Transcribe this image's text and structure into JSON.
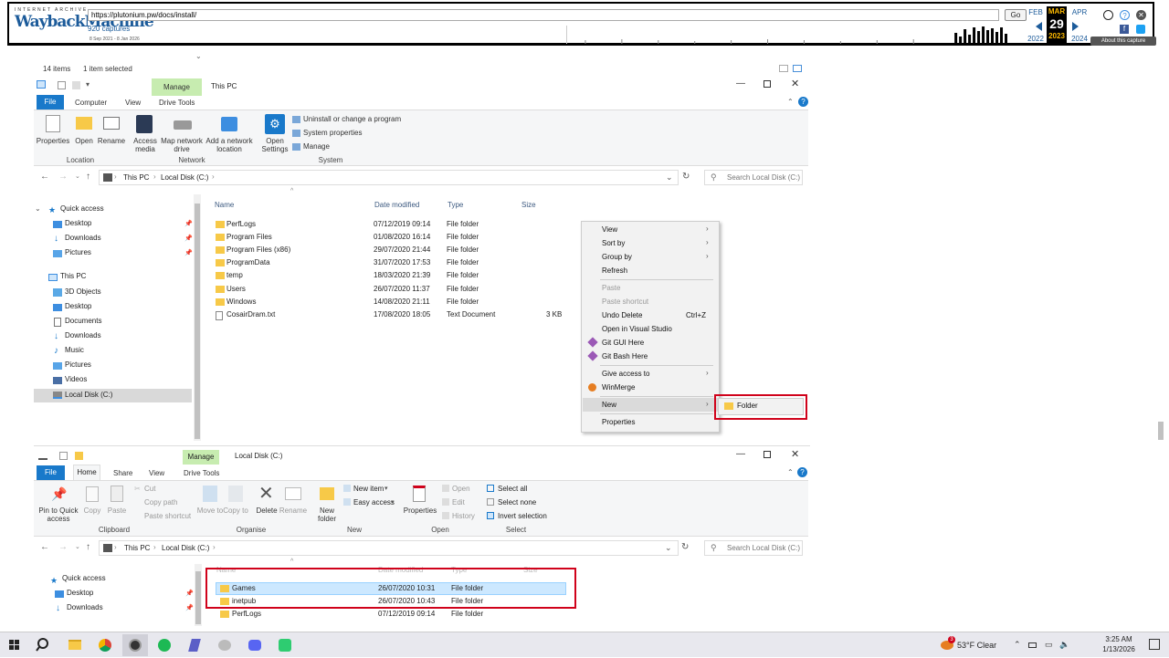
{
  "wayback": {
    "logo_top": "INTERNET ARCHIVE",
    "logo_main": "WaybackMachine",
    "url": "https://plutonium.pw/docs/install/",
    "go": "Go",
    "captures": "920 captures",
    "range": "8 Sep 2021 - 8 Jan 2026",
    "prev_month": "FEB",
    "cur_month": "MAR",
    "cur_day": "29",
    "cur_year": "2023",
    "next_month": "APR",
    "prev_year": "2022",
    "next_year": "2024",
    "about": "About this capture"
  },
  "status": {
    "items": "14 items",
    "selected": "1 item selected"
  },
  "win1": {
    "manage_tab": "Manage",
    "title": "This PC",
    "tabs": [
      "File",
      "Computer",
      "View",
      "Drive Tools"
    ],
    "ribbon": {
      "properties": "Properties",
      "open": "Open",
      "rename": "Rename",
      "access_media": "Access media",
      "map_drive": "Map network drive",
      "add_location": "Add a network location",
      "open_settings": "Open Settings",
      "uninstall": "Uninstall or change a program",
      "system_props": "System properties",
      "manage": "Manage",
      "group_location": "Location",
      "group_network": "Network",
      "group_system": "System"
    },
    "breadcrumb": [
      "This PC",
      "Local Disk (C:)"
    ],
    "search_placeholder": "Search Local Disk (C:)",
    "nav": [
      {
        "label": "Quick access"
      },
      {
        "label": "Desktop"
      },
      {
        "label": "Downloads"
      },
      {
        "label": "Pictures"
      },
      {
        "label": "This PC"
      },
      {
        "label": "3D Objects"
      },
      {
        "label": "Desktop"
      },
      {
        "label": "Documents"
      },
      {
        "label": "Downloads"
      },
      {
        "label": "Music"
      },
      {
        "label": "Pictures"
      },
      {
        "label": "Videos"
      },
      {
        "label": "Local Disk (C:)"
      }
    ],
    "columns": {
      "name": "Name",
      "date": "Date modified",
      "type": "Type",
      "size": "Size"
    },
    "files": [
      {
        "name": "PerfLogs",
        "date": "07/12/2019 09:14",
        "type": "File folder",
        "size": ""
      },
      {
        "name": "Program Files",
        "date": "01/08/2020 16:14",
        "type": "File folder",
        "size": ""
      },
      {
        "name": "Program Files (x86)",
        "date": "29/07/2020 21:44",
        "type": "File folder",
        "size": ""
      },
      {
        "name": "ProgramData",
        "date": "31/07/2020 17:53",
        "type": "File folder",
        "size": ""
      },
      {
        "name": "temp",
        "date": "18/03/2020 21:39",
        "type": "File folder",
        "size": ""
      },
      {
        "name": "Users",
        "date": "26/07/2020 11:37",
        "type": "File folder",
        "size": ""
      },
      {
        "name": "Windows",
        "date": "14/08/2020 21:11",
        "type": "File folder",
        "size": ""
      },
      {
        "name": "CosairDram.txt",
        "date": "17/08/2020 18:05",
        "type": "Text Document",
        "size": "3 KB"
      }
    ]
  },
  "context_menu": {
    "view": "View",
    "sort_by": "Sort by",
    "group_by": "Group by",
    "refresh": "Refresh",
    "paste": "Paste",
    "paste_shortcut": "Paste shortcut",
    "undo_delete": "Undo Delete",
    "undo_shortcut": "Ctrl+Z",
    "open_vs": "Open in Visual Studio",
    "git_gui": "Git GUI Here",
    "git_bash": "Git Bash Here",
    "give_access": "Give access to",
    "winmerge": "WinMerge",
    "new": "New",
    "properties": "Properties",
    "submenu_folder": "Folder"
  },
  "win2": {
    "manage_tab": "Manage",
    "title": "Local Disk (C:)",
    "tabs": [
      "File",
      "Home",
      "Share",
      "View",
      "Drive Tools"
    ],
    "ribbon": {
      "pin": "Pin to Quick access",
      "copy": "Copy",
      "paste": "Paste",
      "cut": "Cut",
      "copy_path": "Copy path",
      "paste_shortcut": "Paste shortcut",
      "move_to": "Move to",
      "copy_to": "Copy to",
      "delete": "Delete",
      "rename": "Rename",
      "new_folder": "New folder",
      "new_item": "New item",
      "easy_access": "Easy access",
      "properties": "Properties",
      "open": "Open",
      "edit": "Edit",
      "history": "History",
      "select_all": "Select all",
      "select_none": "Select none",
      "invert": "Invert selection",
      "group_clipboard": "Clipboard",
      "group_organise": "Organise",
      "group_new": "New",
      "group_open": "Open",
      "group_select": "Select"
    },
    "breadcrumb": [
      "This PC",
      "Local Disk (C:)"
    ],
    "search_placeholder": "Search Local Disk (C:)",
    "nav": [
      {
        "label": "Quick access"
      },
      {
        "label": "Desktop"
      },
      {
        "label": "Downloads"
      }
    ],
    "columns": {
      "name": "Name",
      "date": "Date modified",
      "type": "Type",
      "size": "Size"
    },
    "files": [
      {
        "name": "Games",
        "date": "26/07/2020 10:31",
        "type": "File folder"
      },
      {
        "name": "inetpub",
        "date": "26/07/2020 10:43",
        "type": "File folder"
      },
      {
        "name": "PerfLogs",
        "date": "07/12/2019 09:14",
        "type": "File folder"
      }
    ]
  },
  "taskbar": {
    "weather": "53°F Clear",
    "weather_badge": "3",
    "time": "3:25 AM",
    "date": "1/13/2026"
  },
  "colors": {
    "accent": "#1979ca",
    "highlight_red": "#d0021b",
    "selection": "#cce8ff",
    "manage_green": "#c7ecb0"
  }
}
